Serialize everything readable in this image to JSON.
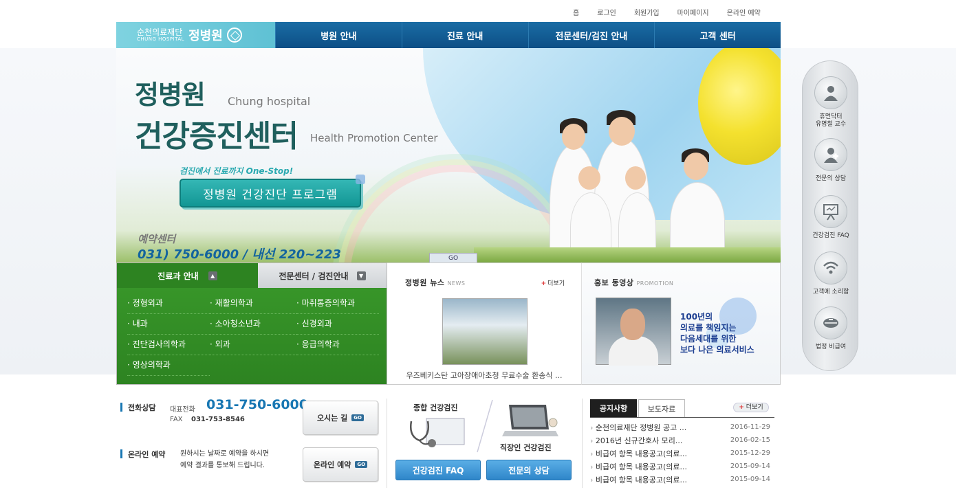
{
  "util_links": [
    "홈",
    "로그인",
    "회원가입",
    "마이페이지",
    "온라인 예약"
  ],
  "logo": {
    "line1": "순천의료재단",
    "line2": "CHUNG HOSPITAL",
    "name": "정병원"
  },
  "menu": [
    "병원 안내",
    "진료 안내",
    "전문센터/검진 안내",
    "고객 센터"
  ],
  "hero": {
    "title1": "정병원",
    "sub1": "Chung hospital",
    "title2": "건강증진센터",
    "sub2": "Health Promotion Center",
    "onestop": "검진에서 진료까지 One-Stop!",
    "program_button": "정병원 건강진단 프로그램",
    "reservation_label": "예약센터",
    "reservation_number": "031) 750-6000 / 내선 220~223",
    "goto_label": "GO"
  },
  "quick_menu": [
    {
      "label": "휴먼닥터\n유명철 교수",
      "icon": "doctor-icon"
    },
    {
      "label": "전문의 상담",
      "icon": "consult-icon"
    },
    {
      "label": "건강검진 FAQ",
      "icon": "faq-board-icon"
    },
    {
      "label": "고객에 소리함",
      "icon": "wifi-icon"
    },
    {
      "label": "법정 비급여",
      "icon": "pill-icon"
    }
  ],
  "dept_panel": {
    "tab1": "진료과 안내",
    "tab2": "전문센터 / 검진안내",
    "depts": [
      "정형외과",
      "재활의학과",
      "마취통증의학과",
      "내과",
      "소아청소년과",
      "신경외과",
      "진단검사의학과",
      "외과",
      "응급의학과",
      "영상의학과"
    ]
  },
  "news": {
    "title": "정병원 뉴스",
    "tag": "NEWS",
    "more": "더보기",
    "caption": "우즈베키스탄 고아장애아초청 무료수술 환송식 ..."
  },
  "promo": {
    "title": "홍보 동영상",
    "tag": "PROMOTION",
    "text": [
      "100년의",
      "의료를 책임지는",
      "다음세대를 위한",
      "보다 나은 의료서비스"
    ]
  },
  "contact": {
    "phone_label": "전화상담",
    "rep_label": "대표전화",
    "phone": "031-750-6000",
    "fax_label": "FAX",
    "fax": "031-753-8546",
    "online_label": "온라인 예약",
    "online_desc1": "원하시는 날짜로 예약을 하시면",
    "online_desc2": "예약 결과를 통보해 드립니다.",
    "btn_directions": "오시는 길",
    "btn_online": "온라인 예약",
    "go": "GO"
  },
  "checkup": {
    "general": "종합 건강검진",
    "work": "직장인 건강검진",
    "btn_faq": "건강검진 FAQ",
    "btn_consult": "전문의 상담"
  },
  "notice": {
    "tab_on": "공지사항",
    "tab_off": "보도자료",
    "more": "더보기",
    "items": [
      {
        "title": "순천의료재단 정병원 공고 ...",
        "date": "2016-11-29"
      },
      {
        "title": "2016년 신규간호사 모리...",
        "date": "2016-02-15"
      },
      {
        "title": "비급여 항목 내용공고(의료...",
        "date": "2015-12-29"
      },
      {
        "title": "비급여 항목 내용공고(의료...",
        "date": "2015-09-14"
      },
      {
        "title": "비급여 항목 내용공고(의료...",
        "date": "2015-09-14"
      }
    ]
  },
  "colors": {
    "nav": "#0d4f86",
    "logo": "#5fc1d4",
    "green": "#2d8321",
    "accent": "#1877b3"
  }
}
